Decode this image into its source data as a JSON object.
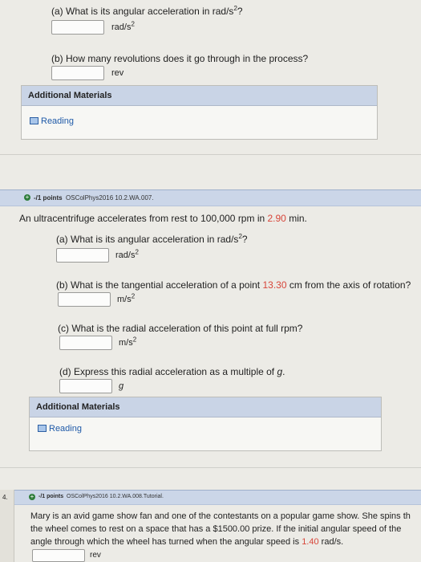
{
  "prev_question": {
    "part_a": {
      "prompt_prefix": "(a) What is its angular acceleration in rad/s",
      "prompt_sup": "2",
      "prompt_suffix": "?",
      "unit": "rad/s",
      "unit_sup": "2",
      "value": ""
    },
    "part_b": {
      "prompt": "(b) How many revolutions does it go through in the process?",
      "unit": "rev",
      "value": ""
    },
    "materials_title": "Additional Materials",
    "reading_label": "Reading"
  },
  "question_3": {
    "points": "-/1 points",
    "code": "OSColPhys2016 10.2.WA.007.",
    "stem_before": "An ultracentrifuge accelerates from rest to 100,000 rpm in ",
    "stem_highlight": "2.90",
    "stem_after": " min.",
    "part_a": {
      "prompt_prefix": "(a) What is its angular acceleration in rad/s",
      "prompt_sup": "2",
      "prompt_suffix": "?",
      "unit": "rad/s",
      "unit_sup": "2",
      "value": ""
    },
    "part_b": {
      "prompt_before": "(b) What is the tangential acceleration of a point ",
      "prompt_highlight": "13.30",
      "prompt_after": " cm from the axis of rotation?",
      "unit": "m/s",
      "unit_sup": "2",
      "value": ""
    },
    "part_c": {
      "prompt": "(c) What is the radial acceleration of this point at full rpm?",
      "unit": "m/s",
      "unit_sup": "2",
      "value": ""
    },
    "part_d": {
      "prompt_before": "(d) Express this radial acceleration as a multiple of ",
      "prompt_var": "g",
      "prompt_after": ".",
      "unit": "g",
      "value": ""
    },
    "materials_title": "Additional Materials",
    "reading_label": "Reading"
  },
  "question_4": {
    "number": "4.",
    "points": "-/1 points",
    "code": "OSColPhys2016 10.2.WA.008.Tutorial.",
    "line1": "Mary is an avid game show fan and one of the contestants on a popular game show. She spins th",
    "line2_before": "the wheel comes to rest on a space that has a $1500.00 prize. If the initial angular spe",
    "line2_obscured": "ed",
    "line2_after": " of the",
    "line3_before": "angle through which the wheel has turned when the angular speed is ",
    "line3_highlight": "1.40",
    "line3_after": " rad/s.",
    "unit": "rev",
    "value": ""
  },
  "colors": {
    "accent_header": "#cbd6e8",
    "highlight": "#d7463a",
    "link": "#1f5aa8"
  }
}
